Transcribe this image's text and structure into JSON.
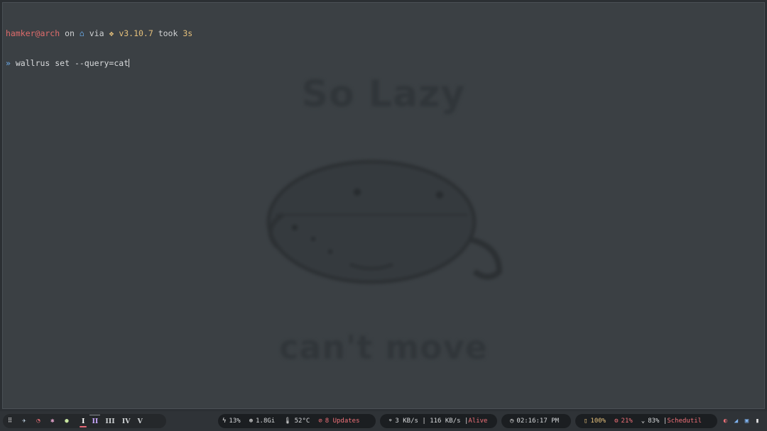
{
  "terminal": {
    "prompt": {
      "user_host": "hamker@arch",
      "on": " on ",
      "home_icon": "home-icon",
      "via": " via ",
      "python_icon": "python-icon",
      "python_version": "v3.10.7",
      "took": " took ",
      "duration": "3s"
    },
    "command_prompt_symbol": "»",
    "command": "wallrus set --query=cat"
  },
  "wallpaper": {
    "top_text": "So Lazy",
    "bottom_text": "can't move"
  },
  "taskbar": {
    "apps": [
      {
        "name": "app-grid-icon",
        "glyph": "⠿"
      },
      {
        "name": "telegram-icon",
        "glyph": "✈"
      },
      {
        "name": "debian-swirl-icon",
        "glyph": "◔"
      },
      {
        "name": "slack-icon",
        "glyph": "✱"
      },
      {
        "name": "spotify-icon",
        "glyph": "●"
      }
    ],
    "workspaces": [
      "I",
      "II",
      "III",
      "IV",
      "V"
    ],
    "system": {
      "battery_charge": "13%",
      "memory": "1.8Gi",
      "temperature": "52°C",
      "updates": "8 Updates"
    },
    "network": {
      "speed": "3 KB/s | 116 KB/s | ",
      "status": "Alive"
    },
    "clock": {
      "time": "02:16:17 PM"
    },
    "power": {
      "battery": "100%",
      "cpu": "21%",
      "brightness": "83% | ",
      "governor": "Schedutil"
    },
    "tray": [
      "github-icon",
      "signal-icon",
      "printer-icon",
      "battery-icon"
    ]
  },
  "colors": {
    "accent_red": "#f07178",
    "accent_yellow": "#e5c07b",
    "accent_blue": "#7fb3f0"
  }
}
